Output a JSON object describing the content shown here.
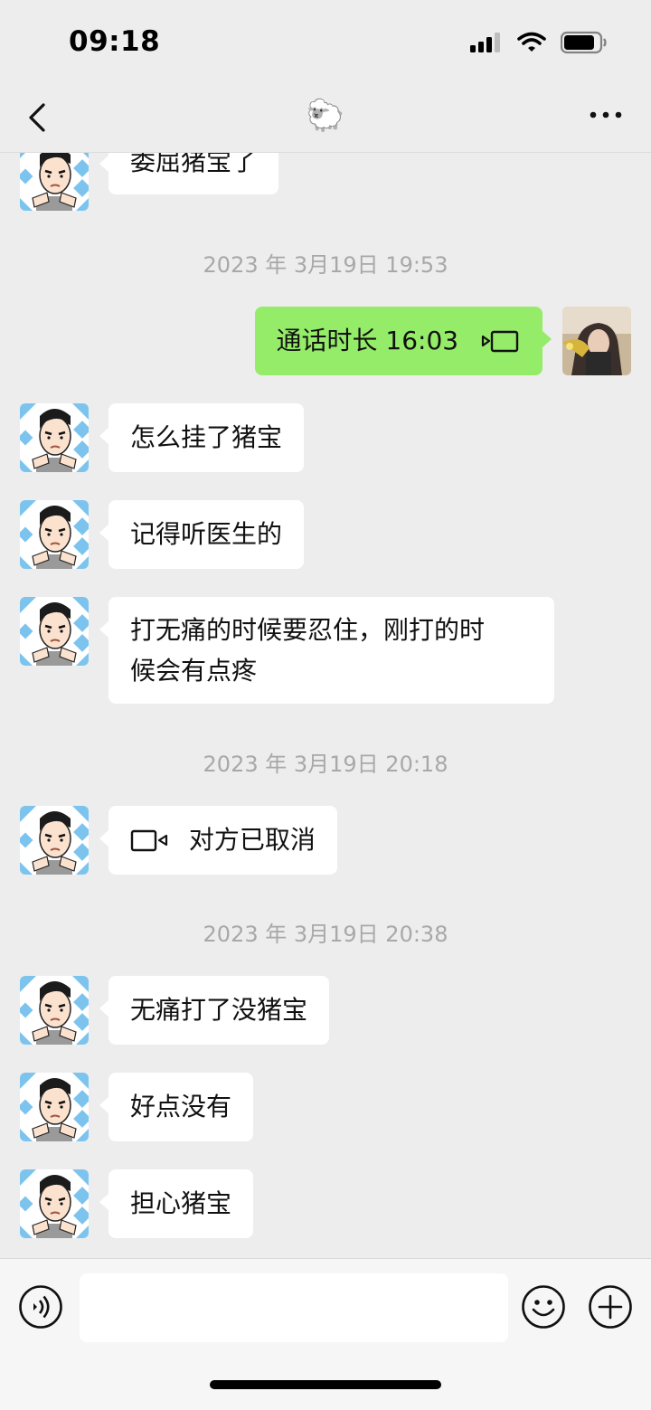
{
  "status": {
    "time": "09:18"
  },
  "nav": {
    "title": "🐑"
  },
  "messages": {
    "m1": "委屈猪宝了",
    "ts1": "2023 年 3月19日 19:53",
    "call_me": "通话时长 16:03",
    "m2": "怎么挂了猪宝",
    "m3": "记得听医生的",
    "m4_line1": "打无痛的时候要忍住，刚打的时",
    "m4_line2": "候会有点疼",
    "ts2": "2023 年 3月19日 20:18",
    "call_cancel": "对方已取消",
    "ts3": "2023 年 3月19日 20:38",
    "m5": "无痛打了没猪宝",
    "m6": "好点没有",
    "m7": "担心猪宝"
  },
  "colors": {
    "background": "#ededed",
    "my_bubble": "#95ec69",
    "their_bubble": "#ffffff",
    "timestamp": "#a8a8a8"
  },
  "icons": {
    "back": "chevron-left-icon",
    "more": "more-dots-icon",
    "video": "video-call-icon",
    "voice": "voice-input-icon",
    "emoji": "emoji-icon",
    "plus": "plus-icon"
  }
}
